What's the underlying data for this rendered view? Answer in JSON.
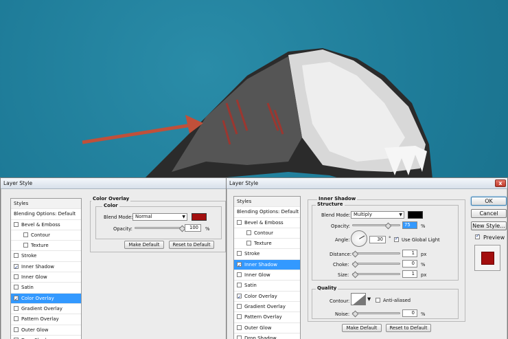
{
  "colors": {
    "arrow": "#c0503a",
    "overlay_color": "#a30f0f",
    "shadow_color": "#000000",
    "selection": "#3399ff"
  },
  "back_dialog": {
    "title": "Layer Style",
    "styles_header": "Styles",
    "items": [
      {
        "label": "Blending Options: Default",
        "checkbox": false,
        "checked": false,
        "indent": false,
        "selected": false
      },
      {
        "label": "Bevel & Emboss",
        "checkbox": true,
        "checked": false,
        "indent": false,
        "selected": false
      },
      {
        "label": "Contour",
        "checkbox": true,
        "checked": false,
        "indent": true,
        "selected": false
      },
      {
        "label": "Texture",
        "checkbox": true,
        "checked": false,
        "indent": true,
        "selected": false
      },
      {
        "label": "Stroke",
        "checkbox": true,
        "checked": false,
        "indent": false,
        "selected": false
      },
      {
        "label": "Inner Shadow",
        "checkbox": true,
        "checked": true,
        "indent": false,
        "selected": false
      },
      {
        "label": "Inner Glow",
        "checkbox": true,
        "checked": false,
        "indent": false,
        "selected": false
      },
      {
        "label": "Satin",
        "checkbox": true,
        "checked": false,
        "indent": false,
        "selected": false
      },
      {
        "label": "Color Overlay",
        "checkbox": true,
        "checked": true,
        "indent": false,
        "selected": true
      },
      {
        "label": "Gradient Overlay",
        "checkbox": true,
        "checked": false,
        "indent": false,
        "selected": false
      },
      {
        "label": "Pattern Overlay",
        "checkbox": true,
        "checked": false,
        "indent": false,
        "selected": false
      },
      {
        "label": "Outer Glow",
        "checkbox": true,
        "checked": false,
        "indent": false,
        "selected": false
      },
      {
        "label": "Drop Shadow",
        "checkbox": true,
        "checked": false,
        "indent": false,
        "selected": false
      }
    ],
    "panel_title": "Color Overlay",
    "group_title": "Color",
    "blend_mode_label": "Blend Mode:",
    "blend_mode_value": "Normal",
    "opacity_label": "Opacity:",
    "opacity_value": "100",
    "opacity_unit": "%",
    "opacity_level": 1.0,
    "make_default": "Make Default",
    "reset_default": "Reset to Default"
  },
  "front_dialog": {
    "title": "Layer Style",
    "close": "x",
    "styles_header": "Styles",
    "items": [
      {
        "label": "Blending Options: Default",
        "checkbox": false,
        "checked": false,
        "indent": false,
        "selected": false
      },
      {
        "label": "Bevel & Emboss",
        "checkbox": true,
        "checked": false,
        "indent": false,
        "selected": false
      },
      {
        "label": "Contour",
        "checkbox": true,
        "checked": false,
        "indent": true,
        "selected": false
      },
      {
        "label": "Texture",
        "checkbox": true,
        "checked": false,
        "indent": true,
        "selected": false
      },
      {
        "label": "Stroke",
        "checkbox": true,
        "checked": false,
        "indent": false,
        "selected": false
      },
      {
        "label": "Inner Shadow",
        "checkbox": true,
        "checked": true,
        "indent": false,
        "selected": true
      },
      {
        "label": "Inner Glow",
        "checkbox": true,
        "checked": false,
        "indent": false,
        "selected": false
      },
      {
        "label": "Satin",
        "checkbox": true,
        "checked": false,
        "indent": false,
        "selected": false
      },
      {
        "label": "Color Overlay",
        "checkbox": true,
        "checked": true,
        "indent": false,
        "selected": false
      },
      {
        "label": "Gradient Overlay",
        "checkbox": true,
        "checked": false,
        "indent": false,
        "selected": false
      },
      {
        "label": "Pattern Overlay",
        "checkbox": true,
        "checked": false,
        "indent": false,
        "selected": false
      },
      {
        "label": "Outer Glow",
        "checkbox": true,
        "checked": false,
        "indent": false,
        "selected": false
      },
      {
        "label": "Drop Shadow",
        "checkbox": true,
        "checked": false,
        "indent": false,
        "selected": false
      }
    ],
    "panel_title": "Inner Shadow",
    "structure_title": "Structure",
    "blend_mode_label": "Blend Mode:",
    "blend_mode_value": "Multiply",
    "opacity_label": "Opacity:",
    "opacity_value": "75",
    "opacity_unit": "%",
    "opacity_level": 0.75,
    "angle_label": "Angle:",
    "angle_value": "30",
    "angle_unit": "°",
    "use_global_light": "Use Global Light",
    "distance_label": "Distance:",
    "distance_value": "1",
    "distance_unit": "px",
    "choke_label": "Choke:",
    "choke_value": "0",
    "choke_unit": "%",
    "size_label": "Size:",
    "size_value": "1",
    "size_unit": "px",
    "quality_title": "Quality",
    "contour_label": "Contour:",
    "anti_aliased": "Anti-aliased",
    "noise_label": "Noise:",
    "noise_value": "0",
    "noise_unit": "%",
    "make_default": "Make Default",
    "reset_default": "Reset to Default",
    "ok": "OK",
    "cancel": "Cancel",
    "new_style": "New Style...",
    "preview": "Preview"
  }
}
